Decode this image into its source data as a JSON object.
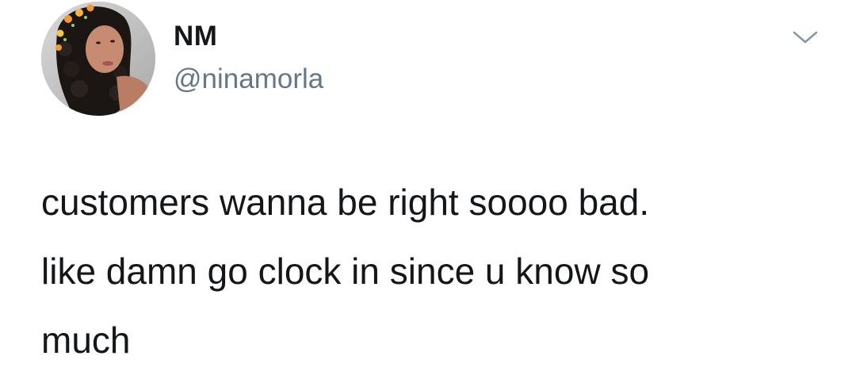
{
  "tweet": {
    "author": {
      "display_name": "NM",
      "handle": "@ninamorla",
      "avatar_icon": "profile-photo-avatar"
    },
    "menu_icon": "chevron-down-icon",
    "text_lines": [
      "customers wanna be right soooo bad.",
      "like damn go clock in since u know so",
      "much"
    ]
  },
  "colors": {
    "text": "#14171a",
    "secondary_text": "#657786",
    "chevron": "#8899a6",
    "background": "#ffffff"
  }
}
